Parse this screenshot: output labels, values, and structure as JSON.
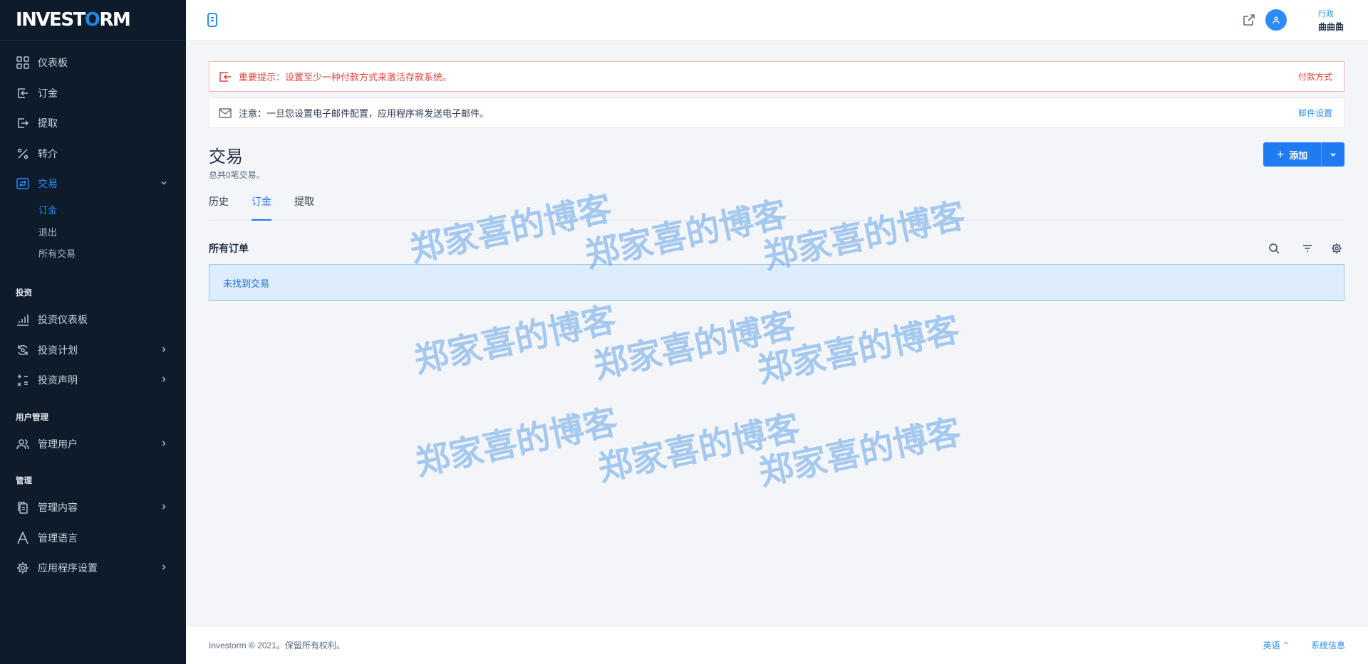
{
  "brand": {
    "logo_pre": "INVEST",
    "logo_o": "O",
    "logo_post": "RM"
  },
  "sidebar": {
    "items_top": [
      {
        "label": "仪表板",
        "icon": "dashboard-icon"
      },
      {
        "label": "订金",
        "icon": "deposit-icon"
      },
      {
        "label": "提取",
        "icon": "withdraw-icon"
      },
      {
        "label": "转介",
        "icon": "percent-icon"
      },
      {
        "label": "交易",
        "icon": "transactions-icon"
      }
    ],
    "transaction_sub": [
      "订金",
      "退出",
      "所有交易"
    ],
    "heading_invest": "投资",
    "invest_items": [
      {
        "label": "投资仪表板",
        "icon": "chart-icon"
      },
      {
        "label": "投资计划",
        "icon": "refresh-icon"
      },
      {
        "label": "投资声明",
        "icon": "calculator-icon"
      }
    ],
    "heading_users": "用户管理",
    "users_items": [
      {
        "label": "管理用户",
        "icon": "users-icon"
      }
    ],
    "heading_manage": "管理",
    "manage_items": [
      {
        "label": "管理内容",
        "icon": "copy-icon"
      },
      {
        "label": "管理语言",
        "icon": "language-icon"
      },
      {
        "label": "应用程序设置",
        "icon": "gear-icon"
      }
    ]
  },
  "topbar": {
    "user_role": "行政",
    "user_name": "曲曲曲"
  },
  "alerts": {
    "payment_text": "重要提示：设置至少一种付款方式来激活存款系统。",
    "payment_link": "付款方式",
    "email_text": "注意：一旦您设置电子邮件配置，应用程序将发送电子邮件。",
    "email_link": "邮件设置"
  },
  "page": {
    "title": "交易",
    "subtitle": "总共0笔交易。",
    "add_label": "添加",
    "tabs": [
      "历史",
      "订金",
      "提取"
    ],
    "active_tab": 1,
    "section_title": "所有订单",
    "empty_text": "未找到交易"
  },
  "footer": {
    "copyright": "Investorm © 2021。保留所有权利。",
    "language": "英语",
    "system_info": "系统信息"
  },
  "watermark": "郑家喜的博客",
  "colors": {
    "accent": "#1e7bf2",
    "sidebar_bg": "#0d1b2a",
    "alert_red": "#e0433b"
  }
}
